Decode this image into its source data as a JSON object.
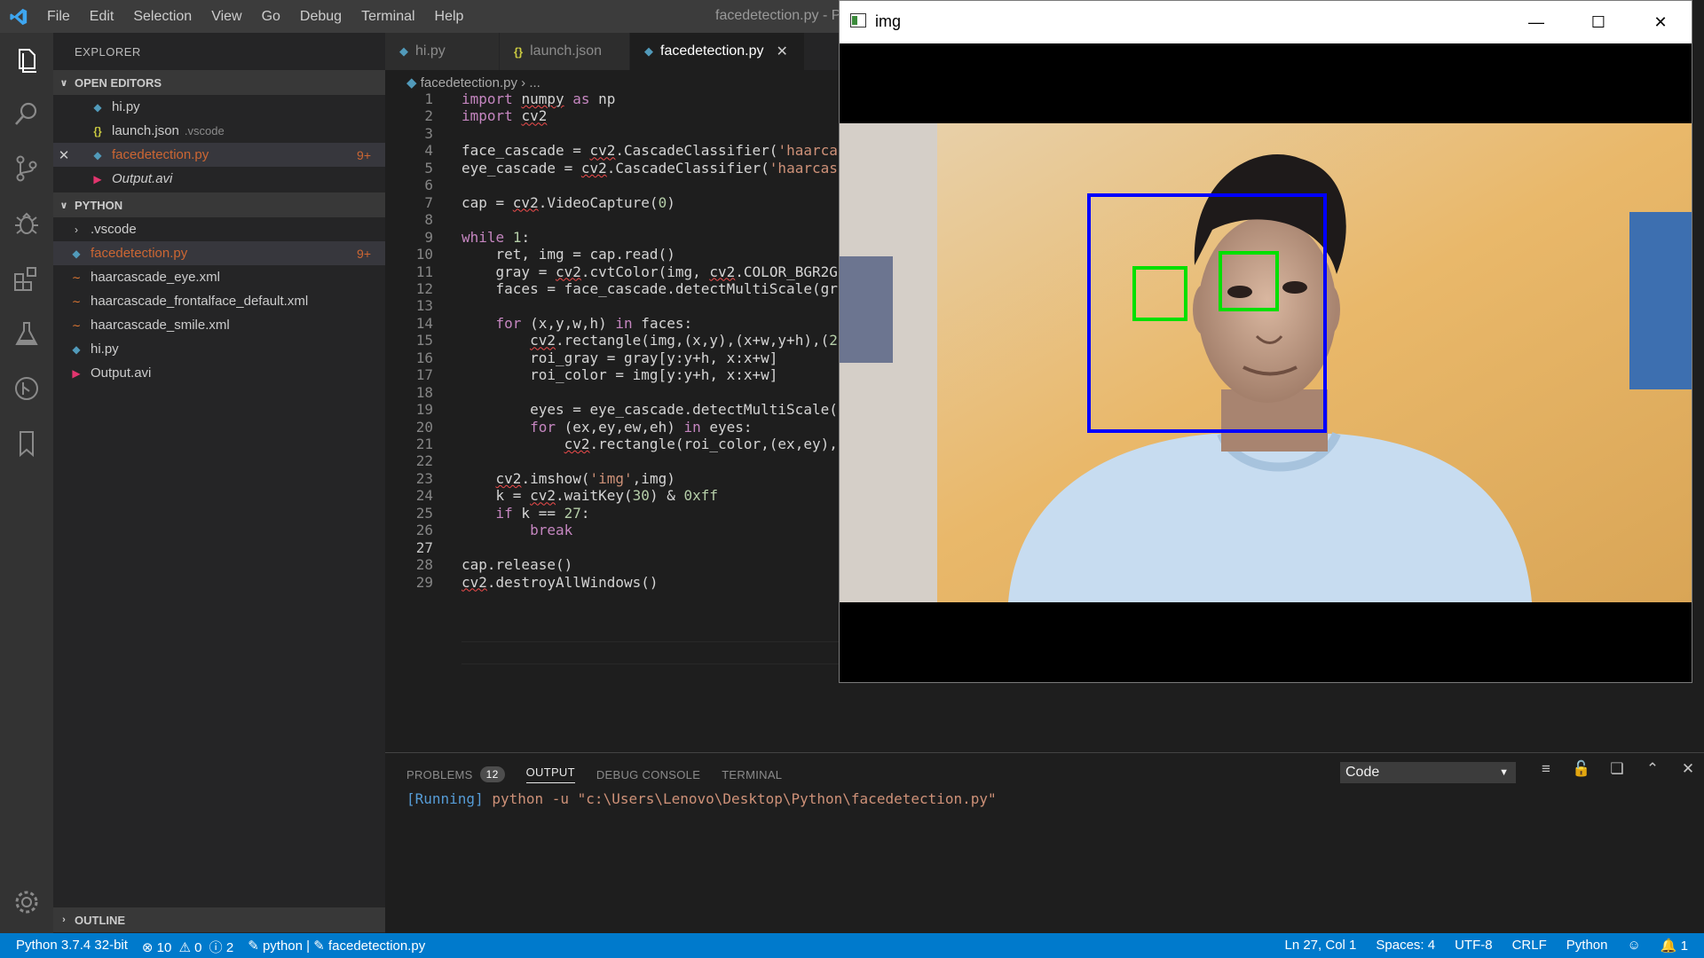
{
  "window": {
    "title": "facedetection.py - Py"
  },
  "menu": [
    "File",
    "Edit",
    "Selection",
    "View",
    "Go",
    "Debug",
    "Terminal",
    "Help"
  ],
  "sidebar": {
    "title": "EXPLORER",
    "open_editors_label": "OPEN EDITORS",
    "open_editors": [
      {
        "name": "hi.py",
        "kind": "py"
      },
      {
        "name": "launch.json",
        "kind": "json",
        "hint": ".vscode"
      },
      {
        "name": "facedetection.py",
        "kind": "py",
        "badge": "9+"
      },
      {
        "name": "Output.avi",
        "kind": "avi"
      }
    ],
    "folder_label": "PYTHON",
    "files": [
      {
        "name": ".vscode",
        "kind": "folder"
      },
      {
        "name": "facedetection.py",
        "kind": "py",
        "badge": "9+"
      },
      {
        "name": "haarcascade_eye.xml",
        "kind": "xml"
      },
      {
        "name": "haarcascade_frontalface_default.xml",
        "kind": "xml"
      },
      {
        "name": "haarcascade_smile.xml",
        "kind": "xml"
      },
      {
        "name": "hi.py",
        "kind": "py"
      },
      {
        "name": "Output.avi",
        "kind": "avi"
      }
    ],
    "outline_label": "OUTLINE"
  },
  "tabs": [
    {
      "label": "hi.py"
    },
    {
      "label": "launch.json"
    },
    {
      "label": "facedetection.py",
      "active": true
    }
  ],
  "breadcrumb": {
    "file": "facedetection.py",
    "rest": "..."
  },
  "code_lines": [
    "import numpy as np",
    "import cv2",
    "",
    "face_cascade = cv2.CascadeClassifier('haarca",
    "eye_cascade = cv2.CascadeClassifier('haarcas",
    "",
    "cap = cv2.VideoCapture(0)",
    "",
    "while 1:",
    "    ret, img = cap.read()",
    "    gray = cv2.cvtColor(img, cv2.COLOR_BGR2G",
    "    faces = face_cascade.detectMultiScale(gr",
    "",
    "    for (x,y,w,h) in faces:",
    "        cv2.rectangle(img,(x,y),(x+w,y+h),(2",
    "        roi_gray = gray[y:y+h, x:x+w]",
    "        roi_color = img[y:y+h, x:x+w]",
    "",
    "        eyes = eye_cascade.detectMultiScale(",
    "        for (ex,ey,ew,eh) in eyes:",
    "            cv2.rectangle(roi_color,(ex,ey),",
    "",
    "    cv2.imshow('img',img)",
    "    k = cv2.waitKey(30) & 0xff",
    "    if k == 27:",
    "        break",
    "",
    "cap.release()",
    "cv2.destroyAllWindows()"
  ],
  "panel": {
    "tabs": [
      "PROBLEMS",
      "OUTPUT",
      "DEBUG CONSOLE",
      "TERMINAL"
    ],
    "problems_count": "12",
    "active_tab": "OUTPUT",
    "channel": "Code",
    "output_running": "[Running]",
    "output_command": " python -u \"c:\\Users\\Lenovo\\Desktop\\Python\\facedetection.py\""
  },
  "statusbar": {
    "interpreter": "Python 3.7.4 32-bit",
    "errors": "10",
    "warnings": "0",
    "infos": "2",
    "run_context": "python | ",
    "run_file": "facedetection.py",
    "position": "Ln 27, Col 1",
    "spaces": "Spaces: 4",
    "encoding": "UTF-8",
    "eol": "CRLF",
    "language": "Python",
    "notifications": "1"
  },
  "image_window": {
    "title": "img",
    "face_box_color": "#0000ff",
    "eye_box_color": "#00ff00"
  },
  "colors": {
    "accent": "#007acc",
    "modified": "#cc6633"
  }
}
